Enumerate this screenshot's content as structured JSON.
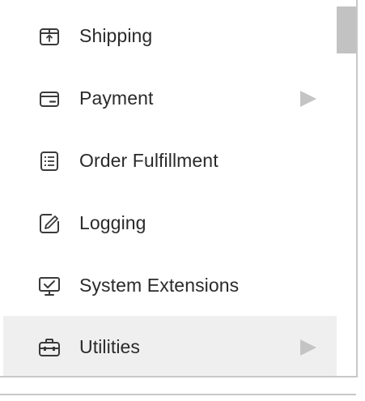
{
  "menu": {
    "items": [
      {
        "label": "Shipping",
        "icon": "shipping-box-icon",
        "has_submenu": false,
        "highlighted": false
      },
      {
        "label": "Payment",
        "icon": "payment-card-icon",
        "has_submenu": true,
        "highlighted": false
      },
      {
        "label": "Order Fulfillment",
        "icon": "order-list-icon",
        "has_submenu": false,
        "highlighted": false
      },
      {
        "label": "Logging",
        "icon": "logging-pencil-icon",
        "has_submenu": false,
        "highlighted": false
      },
      {
        "label": "System Extensions",
        "icon": "system-extensions-monitor-icon",
        "has_submenu": false,
        "highlighted": false
      },
      {
        "label": "Utilities",
        "icon": "utilities-toolbox-icon",
        "has_submenu": true,
        "highlighted": true
      }
    ]
  },
  "colors": {
    "text": "#2a2a2a",
    "icon_stroke": "#3a3a3a",
    "highlight_background": "#efefef",
    "submenu_arrow": "#c4c4c4",
    "scrollbar_thumb": "#c2c2c2",
    "panel_border": "#c8c8c8"
  }
}
